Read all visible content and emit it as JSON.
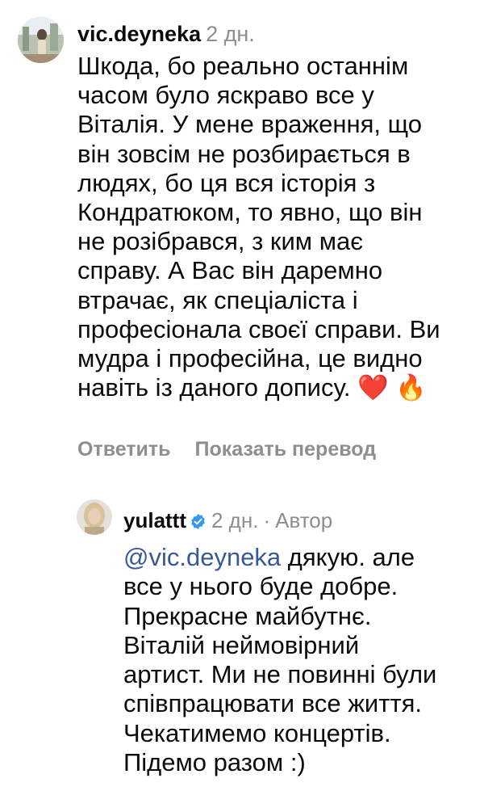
{
  "comment": {
    "username": "vic.deyneka",
    "time": "2 дн.",
    "lines": [
      "Шкода, бо реально останнім",
      "часом було яскраво все у",
      "Віталія. У мене враження, що",
      "він зовсім не розбирається в",
      "людях, бо ця вся історія з",
      "Кондратюком, то явно, що він",
      "не розібрався, з ким має",
      "справу. А Вас він даремно",
      "втрачає, як спеціаліста і",
      "професіонала своєї справи. Ви",
      "мудра і професійна, це видно",
      "навіть із даного допису."
    ],
    "emoji_heart": "❤️",
    "emoji_fire": "🔥",
    "reply_label": "Ответить",
    "translate_label": "Показать перевод"
  },
  "reply": {
    "username": "yulattt",
    "verified": true,
    "time": "2 дн.",
    "separator": "·",
    "author_label": "Автор",
    "mention": "@vic.deyneka",
    "first_line_rest": " дякую. але",
    "lines": [
      "все у нього буде добре.",
      "Прекрасне майбутнє.",
      "Віталій неймовірний",
      "артист. Ми не повинні були",
      "співпрацювати все життя.",
      "Чекатимемо концертів.",
      "Підемо разом :)"
    ]
  },
  "colors": {
    "text": "#0c0c0c",
    "muted": "#8e8e8e",
    "mention": "#385898",
    "verified": "#3897f0"
  }
}
